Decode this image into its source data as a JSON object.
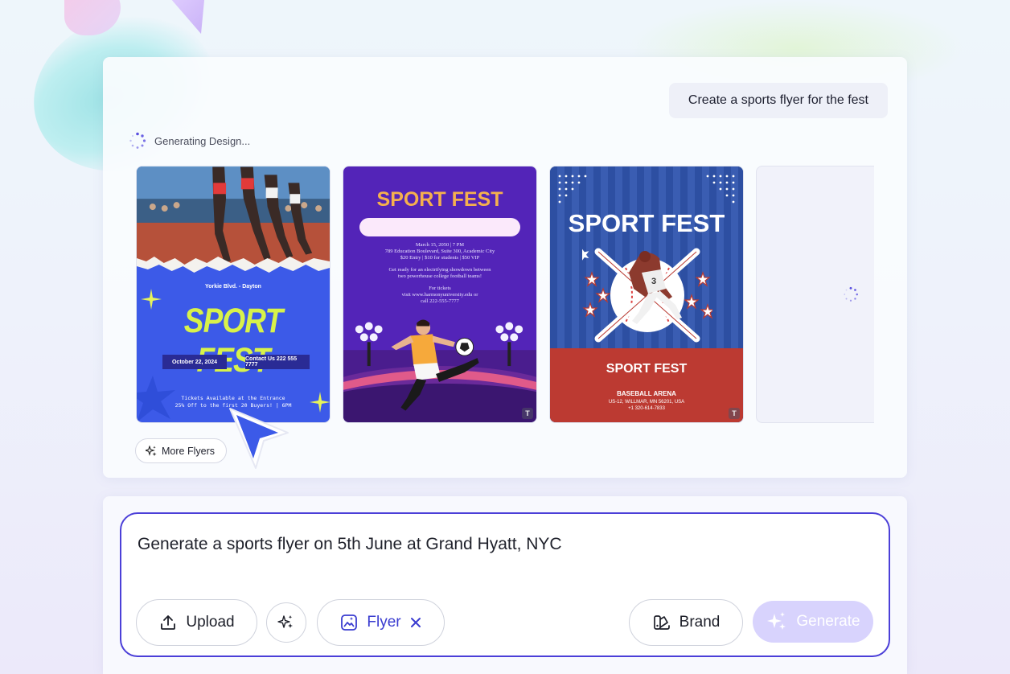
{
  "prompt_bubble": "Create a sports flyer for the fest",
  "status": {
    "label": "Generating Design..."
  },
  "flyers": [
    {
      "address": "Yorkie Blvd. - Dayton",
      "title": "SPORT FEST",
      "date": "October 22, 2024",
      "contact": "Contact Us 222 555 7777",
      "tickets_line1": "Tickets Available at the Entrance",
      "tickets_line2": "25% Off to the first 20 Buyers! | 6PM"
    },
    {
      "title": "SPORT FEST",
      "line1": "March 15, 2050 | 7 PM",
      "line2": "789 Education Boulevard, Suite 300, Academic City",
      "line3": "$20 Entry | $10 for students | $50 VIP",
      "line4": "Get ready for an electrifying showdown between",
      "line5": "two powerhouse college football teams!",
      "line6": "For tickets",
      "line7": "visit www.harmonyuniversity.edu or",
      "line8": "call 222-555-7777",
      "badge": "T"
    },
    {
      "title": "SPORT FEST",
      "subtitle": "SPORT FEST",
      "arena": "BASEBALL ARENA",
      "address": "US-12, WILLMAR, MN 56201, USA",
      "phone": "+1 320-614-7833",
      "badge": "T"
    }
  ],
  "more_button": "More Flyers",
  "composer": {
    "text": "Generate a sports flyer on 5th June at Grand Hyatt, NYC",
    "upload_label": "Upload",
    "flyer_chip_label": "Flyer",
    "brand_label": "Brand",
    "generate_label": "Generate"
  },
  "colors": {
    "accent": "#4b3fd8",
    "generate_disabled": "#d8d3fd",
    "flyer1_bg": "#3c5ae8",
    "flyer2_bg": "#5324b8",
    "flyer3_bg": "#2b4e9e",
    "flyer3_bottom": "#bc3a32"
  },
  "icons": [
    "spinner-icon",
    "sparkle-icon",
    "upload-icon",
    "magic-wand-icon",
    "flyer-image-icon",
    "close-icon",
    "brand-icon",
    "generate-sparkle-icon",
    "cursor-arrow-icon"
  ]
}
